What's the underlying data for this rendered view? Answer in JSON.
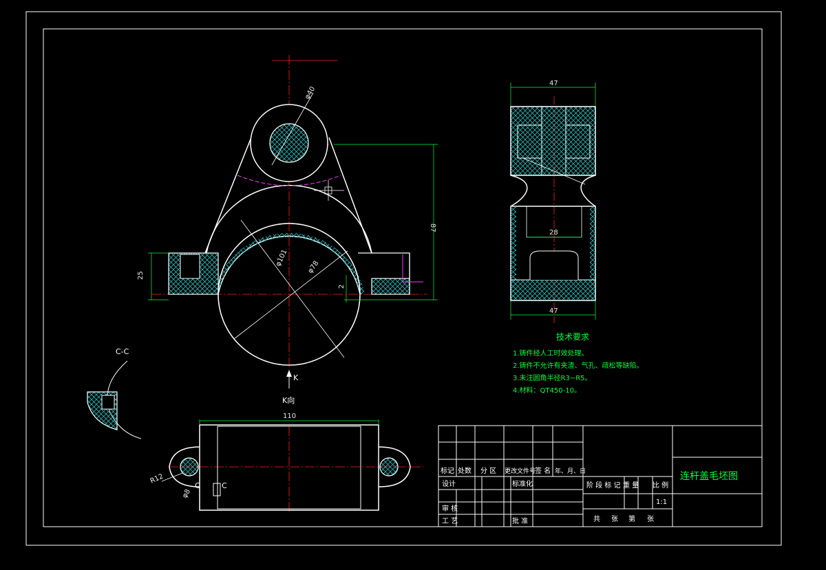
{
  "drawing": {
    "title": "连杆盖毛坯图",
    "scale": "1:1"
  },
  "views": {
    "section_label": "C-C",
    "view_arrow_letter": "K",
    "view_label": "K向",
    "cut_marker": "C"
  },
  "dimensions": {
    "top_phi40": "φ40",
    "dim_87": "87",
    "dim_25": "25",
    "phi101": "φ101",
    "phi78": "φ78",
    "dim_2": "2",
    "side_top_47": "47",
    "side_mid_28": "28",
    "side_bottom_47": "47",
    "bottom_110": "110",
    "r12": "R12",
    "phi8": "φ8"
  },
  "tech_notes": {
    "heading": "技术要求",
    "items": [
      "1.铸件经人工时效处理。",
      "2.铸件不允许有夹渣、气孔、疏松等缺陷。",
      "3.未注圆角半径R3~R5。",
      "4.材料：QT450-10。"
    ]
  },
  "title_block": {
    "rev_headers": [
      "标记",
      "处数",
      "分 区",
      "更改文件号",
      "签 名",
      "年、月、日"
    ],
    "design": "设计",
    "standardize": "标准化",
    "review": "审 核",
    "process": "工 艺",
    "approve": "批 准",
    "stage_mark": "阶 段 标 记",
    "weight": "重 量",
    "scale_label": "比 例",
    "total_sheets": "共",
    "sheets_word": "张",
    "sheet_no": "第",
    "sheet_word2": "张"
  }
}
